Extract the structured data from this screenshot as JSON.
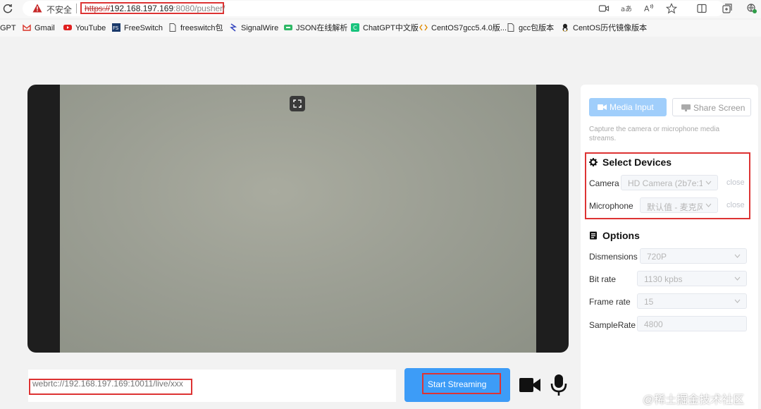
{
  "browser": {
    "security_label": "不安全",
    "url_scheme": "https://",
    "url_host": "192.168.197.169",
    "url_rest": ":8080/pusher/",
    "toolbar_icons": [
      "camera-icon",
      "read-aloud-icon",
      "text-size-icon",
      "favorite-star-icon",
      "split-screen-icon",
      "collections-icon",
      "extensions-icon"
    ],
    "bookmarks": [
      {
        "label": "GPT",
        "icon": "chatgpt-icon"
      },
      {
        "label": "Gmail",
        "icon": "gmail-icon"
      },
      {
        "label": "YouTube",
        "icon": "youtube-icon"
      },
      {
        "label": "FreeSwitch",
        "icon": "freeswitch-icon"
      },
      {
        "label": "freeswitch包",
        "icon": "page-icon"
      },
      {
        "label": "SignalWire",
        "icon": "signalwire-icon"
      },
      {
        "label": "JSON在线解析",
        "icon": "json-icon"
      },
      {
        "label": "ChatGPT中文版",
        "icon": "chatgpt-cn-icon"
      },
      {
        "label": "CentOS7gcc5.4.0版...",
        "icon": "code-icon"
      },
      {
        "label": "gcc包版本",
        "icon": "page-icon"
      },
      {
        "label": "CentOS历代镜像版本",
        "icon": "linux-icon"
      }
    ]
  },
  "player": {
    "stream_url_placeholder": "webrtc://192.168.197.169:10011/live/xxx",
    "start_label": "Start Streaming"
  },
  "panel": {
    "media_input_label": "Media Input",
    "share_screen_label": "Share Screen",
    "hint": "Capture the camera or microphone media streams.",
    "devices": {
      "title": "Select Devices",
      "camera_label": "Camera",
      "camera_value": "HD Camera (2b7e:1",
      "microphone_label": "Microphone",
      "microphone_value": "默认值 - 麦克风",
      "close_label": "close"
    },
    "options": {
      "title": "Options",
      "dimensions_label": "Dismensions",
      "dimensions_value": "720P",
      "bitrate_label": "Bit rate",
      "bitrate_value": "1130 kpbs",
      "framerate_label": "Frame rate",
      "framerate_value": "15",
      "samplerate_label": "SampleRate",
      "samplerate_value": "4800"
    }
  },
  "watermark": "@稀土掘金技术社区",
  "colors": {
    "accent": "#3d9cf7",
    "accent_light": "#a0cefb",
    "highlight": "#d33333"
  }
}
